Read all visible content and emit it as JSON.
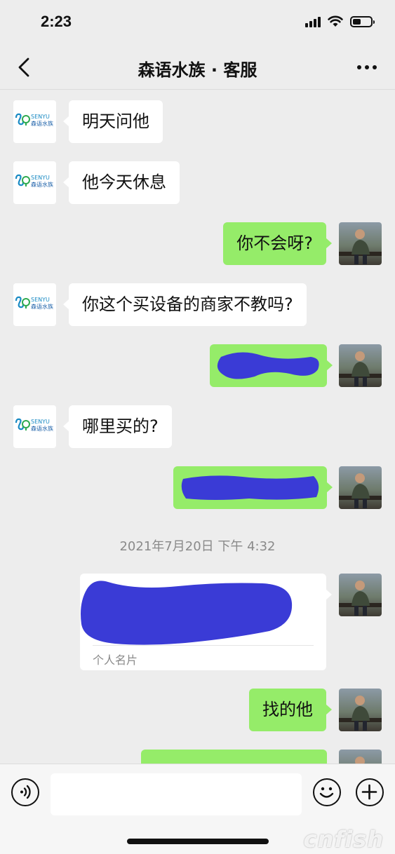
{
  "status_bar": {
    "time": "2:23",
    "battery_level": 0.45
  },
  "nav": {
    "title": "森语水族 · 客服"
  },
  "shop_logo": {
    "wordmark": "SENYU",
    "cn": "森语水族"
  },
  "messages": [
    {
      "side": "in",
      "text": "明天问他"
    },
    {
      "side": "in",
      "text": "他今天休息"
    },
    {
      "side": "out",
      "text": "你不会呀?"
    },
    {
      "side": "in",
      "text": "你这个买设备的商家不教吗?"
    },
    {
      "side": "out",
      "redacted": true
    },
    {
      "side": "in",
      "text": "哪里买的?"
    },
    {
      "side": "out",
      "redacted": true
    },
    {
      "side": "time",
      "text": "2021年7月20日 下午 4:32"
    },
    {
      "side": "out",
      "card": true,
      "label": "个人名片"
    },
    {
      "side": "out",
      "text": "找的他"
    },
    {
      "side": "out",
      "partial": true
    }
  ],
  "input": {
    "placeholder": ""
  },
  "watermark": "cnfish",
  "colors": {
    "background": "#ededed",
    "bubble_out": "#95ec69",
    "bubble_in": "#ffffff",
    "redaction": "#3a3bd6"
  },
  "icons": [
    "back-chevron-icon",
    "more-dots-icon",
    "voice-icon",
    "emoji-icon",
    "plus-icon"
  ]
}
